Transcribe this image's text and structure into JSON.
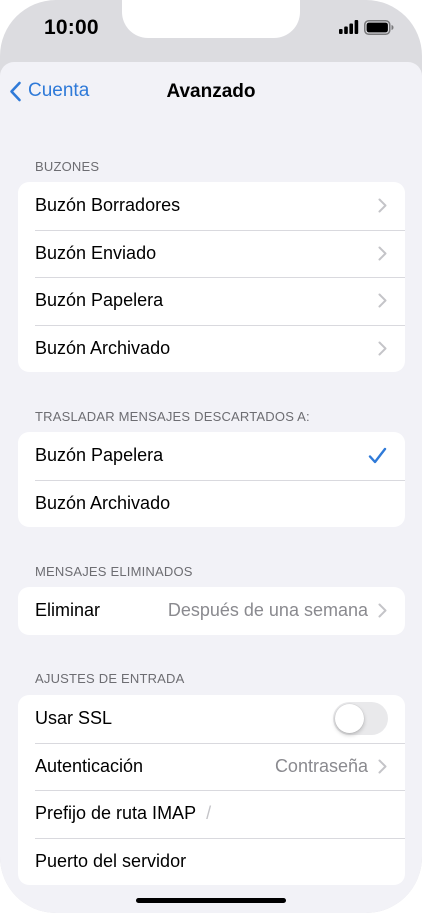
{
  "status_bar": {
    "time": "10:00",
    "icons": [
      "signal-icon",
      "battery-icon"
    ]
  },
  "nav": {
    "back_label": "Cuenta",
    "title": "Avanzado"
  },
  "sections": {
    "mailboxes": {
      "header": "BUZONES",
      "rows": [
        "Buzón Borradores",
        "Buzón Enviado",
        "Buzón Papelera",
        "Buzón Archivado"
      ]
    },
    "move_discarded": {
      "header": "TRASLADAR MENSAJES DESCARTADOS A:",
      "rows": [
        "Buzón Papelera",
        "Buzón Archivado"
      ],
      "selected_index": 0
    },
    "deleted_messages": {
      "header": "MENSAJES ELIMINADOS",
      "row_label": "Eliminar",
      "row_value": "Después de una semana"
    },
    "incoming_settings": {
      "header": "AJUSTES DE ENTRADA",
      "ssl_label": "Usar SSL",
      "ssl_enabled": false,
      "auth_label": "Autenticación",
      "auth_value": "Contraseña",
      "imap_prefix_label": "Prefijo de ruta IMAP",
      "imap_prefix_value": "/",
      "server_port_label": "Puerto del servidor"
    }
  },
  "colors": {
    "accent": "#2f7ad8",
    "background": "#f2f2f7",
    "secondary_text": "#8a8a8f",
    "section_header": "#6d6d72",
    "toggle_off": "#e9e9eb"
  }
}
